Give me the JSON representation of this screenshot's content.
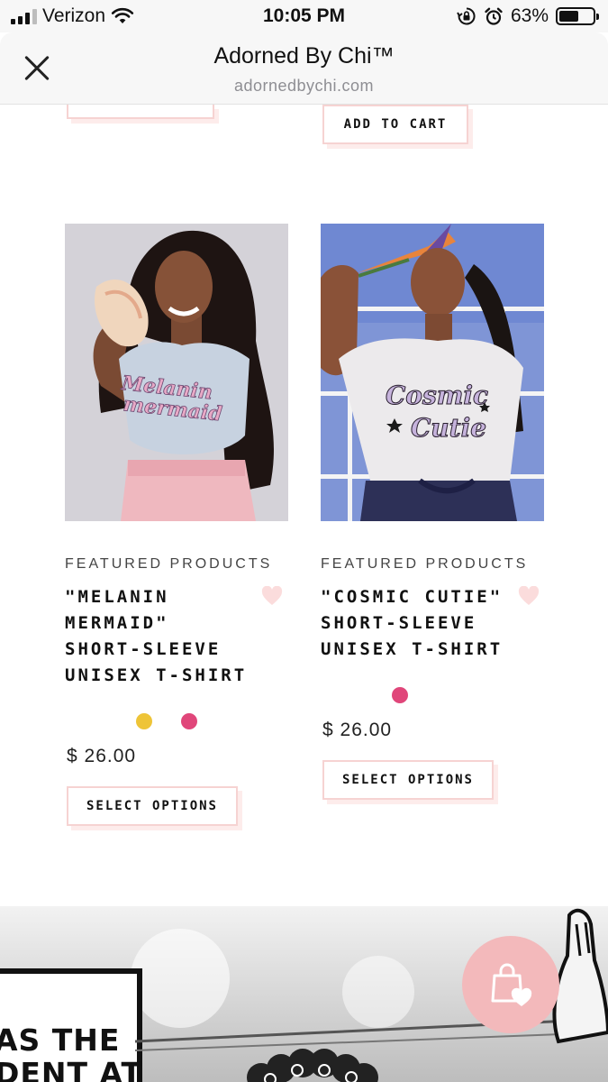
{
  "status_bar": {
    "carrier": "Verizon",
    "time": "10:05 PM",
    "battery_percent": "63%",
    "battery_level": 0.63
  },
  "browser": {
    "title": "Adorned By Chi™",
    "url": "adornedbychi.com"
  },
  "top_row": {
    "add_to_cart_label": "ADD TO CART"
  },
  "products": [
    {
      "category": "FEATURED PRODUCTS",
      "name": "\"Melanin Mermaid\" Short-Sleeve Unisex T-Shirt",
      "shirt_text_1": "Melanin",
      "shirt_text_2": "mermaid",
      "swatches": [
        "#eec437",
        "#e0467a"
      ],
      "price": "$ 26.00",
      "button_label": "SELECT OPTIONS"
    },
    {
      "category": "FEATURED PRODUCTS",
      "name": "\"Cosmic Cutie\" Short-Sleeve Unisex T-Shirt",
      "shirt_text_1": "Cosmic",
      "shirt_text_2": "Cutie",
      "swatches": [
        "#e0467a"
      ],
      "price": "$ 26.00",
      "button_label": "SELECT OPTIONS"
    }
  ],
  "banner": {
    "text_line_1": "AS THE",
    "text_line_2": "DENT AT"
  },
  "colors": {
    "accent_pink": "#f3b9bb",
    "button_border": "#f6d3d2",
    "heart": "#fbdcdc"
  },
  "icons": {
    "close": "close-icon",
    "wishlist": "heart-icon",
    "cart": "shopping-bag-heart-icon"
  }
}
